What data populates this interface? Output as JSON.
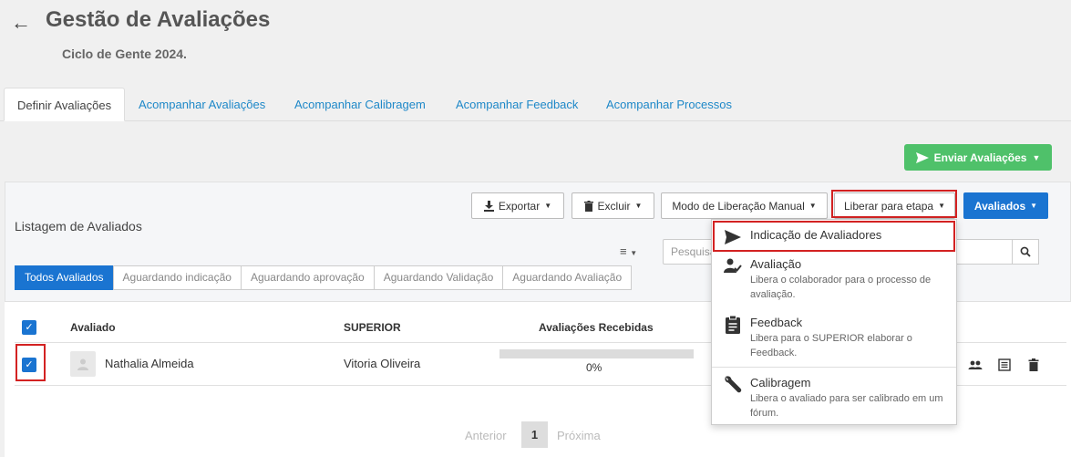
{
  "header": {
    "back_icon": "←",
    "title": "Gestão de Avaliações",
    "subtitle": "Ciclo de Gente 2024."
  },
  "tabs": [
    {
      "label": "Definir Avaliações",
      "active": true
    },
    {
      "label": "Acompanhar Avaliações"
    },
    {
      "label": "Acompanhar Calibragem"
    },
    {
      "label": "Acompanhar Feedback"
    },
    {
      "label": "Acompanhar Processos"
    }
  ],
  "send_button": {
    "label": "Enviar Avaliações",
    "icon": "send-icon",
    "color": "#4fc16a"
  },
  "list": {
    "title": "Listagem de Avaliados"
  },
  "toolbar": {
    "export": "Exportar",
    "delete": "Excluir",
    "release_mode": "Modo de Liberação Manual",
    "release_stage": "Liberar para etapa",
    "evaluated": "Avaliados"
  },
  "search": {
    "placeholder": "Pesquisar"
  },
  "subtabs": [
    "Todos Avaliados",
    "Aguardando indicação",
    "Aguardando aprovação",
    "Aguardando Validação",
    "Aguardando Avaliação"
  ],
  "table": {
    "headers": {
      "evaluated": "Avaliado",
      "superior": "SUPERIOR",
      "received": "Avaliações Recebidas"
    },
    "rows": [
      {
        "name": "Nathalia Almeida",
        "superior": "Vitoria Oliveira",
        "progress": "0%",
        "progress_fraction": 0,
        "checked": true
      }
    ]
  },
  "pagination": {
    "prev": "Anterior",
    "page": "1",
    "next": "Próxima"
  },
  "menu": {
    "items": [
      {
        "title": "Indicação de Avaliadores",
        "desc": "",
        "icon": "send-icon"
      },
      {
        "title": "Avaliação",
        "desc": "Libera o colaborador para o processo de avaliação.",
        "icon": "person-check-icon"
      },
      {
        "title": "Feedback",
        "desc": "Libera para o SUPERIOR elaborar o Feedback.",
        "icon": "clipboard-icon"
      },
      {
        "title": "Calibragem",
        "desc": "Libera o avaliado para ser calibrado em um fórum.",
        "icon": "wrench-icon"
      }
    ]
  },
  "colors": {
    "accent": "#1a74d1",
    "highlight": "#d32222",
    "success": "#4fc16a"
  }
}
